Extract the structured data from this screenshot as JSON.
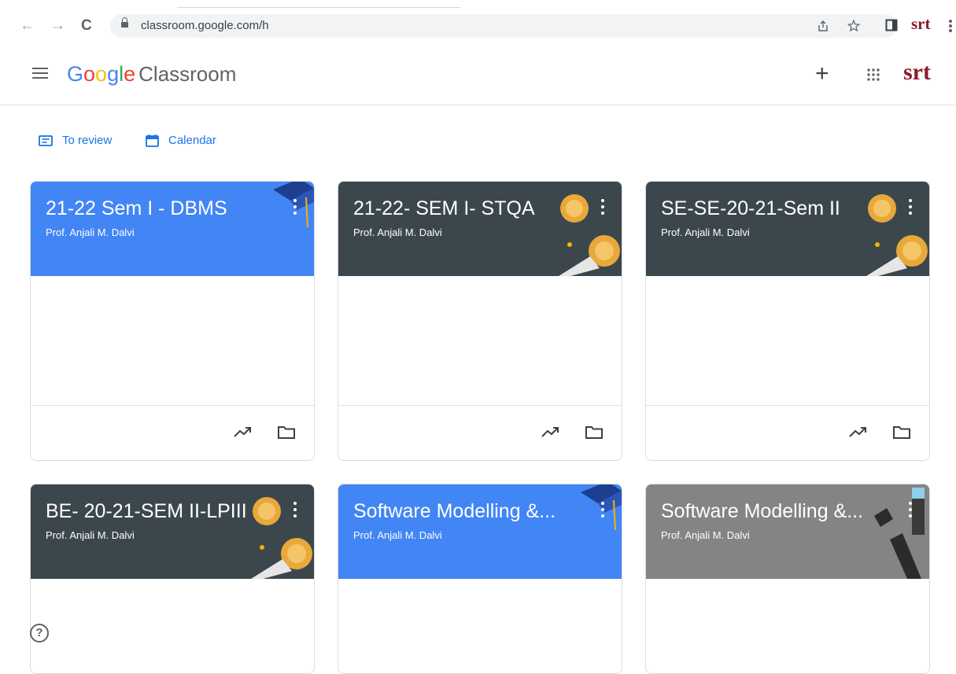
{
  "browser": {
    "url": "classroom.google.com/h",
    "back_glyph": "←",
    "forward_glyph": "→",
    "reload_glyph": "C",
    "profile_text": "srt"
  },
  "app": {
    "logo_letters": [
      "G",
      "o",
      "o",
      "g",
      "l",
      "e"
    ],
    "product": "Classroom",
    "add_glyph": "+",
    "apps_icon": "apps-grid-icon",
    "avatar_text": "srt"
  },
  "nav": {
    "to_review": "To review",
    "calendar": "Calendar"
  },
  "colors": {
    "blue_banner": "#4285f4",
    "dark_banner": "#3c474d",
    "gray_banner": "#848484",
    "link_blue": "#1a73e8"
  },
  "classes": [
    {
      "title": "21-22 Sem I - DBMS",
      "teacher": "Prof. Anjali M. Dalvi",
      "theme": "blue"
    },
    {
      "title": "21-22- SEM I- STQA",
      "teacher": "Prof. Anjali M. Dalvi",
      "theme": "dark"
    },
    {
      "title": "SE-SE-20-21-Sem II",
      "teacher": "Prof. Anjali M. Dalvi",
      "theme": "dark"
    },
    {
      "title": "BE- 20-21-SEM II-LPIII",
      "teacher": "Prof. Anjali M. Dalvi",
      "theme": "dark"
    },
    {
      "title": "Software Modelling &...",
      "teacher": "Prof. Anjali M. Dalvi",
      "theme": "blue"
    },
    {
      "title": "Software Modelling &...",
      "teacher": "Prof. Anjali M. Dalvi",
      "theme": "gray"
    }
  ],
  "help_glyph": "?"
}
